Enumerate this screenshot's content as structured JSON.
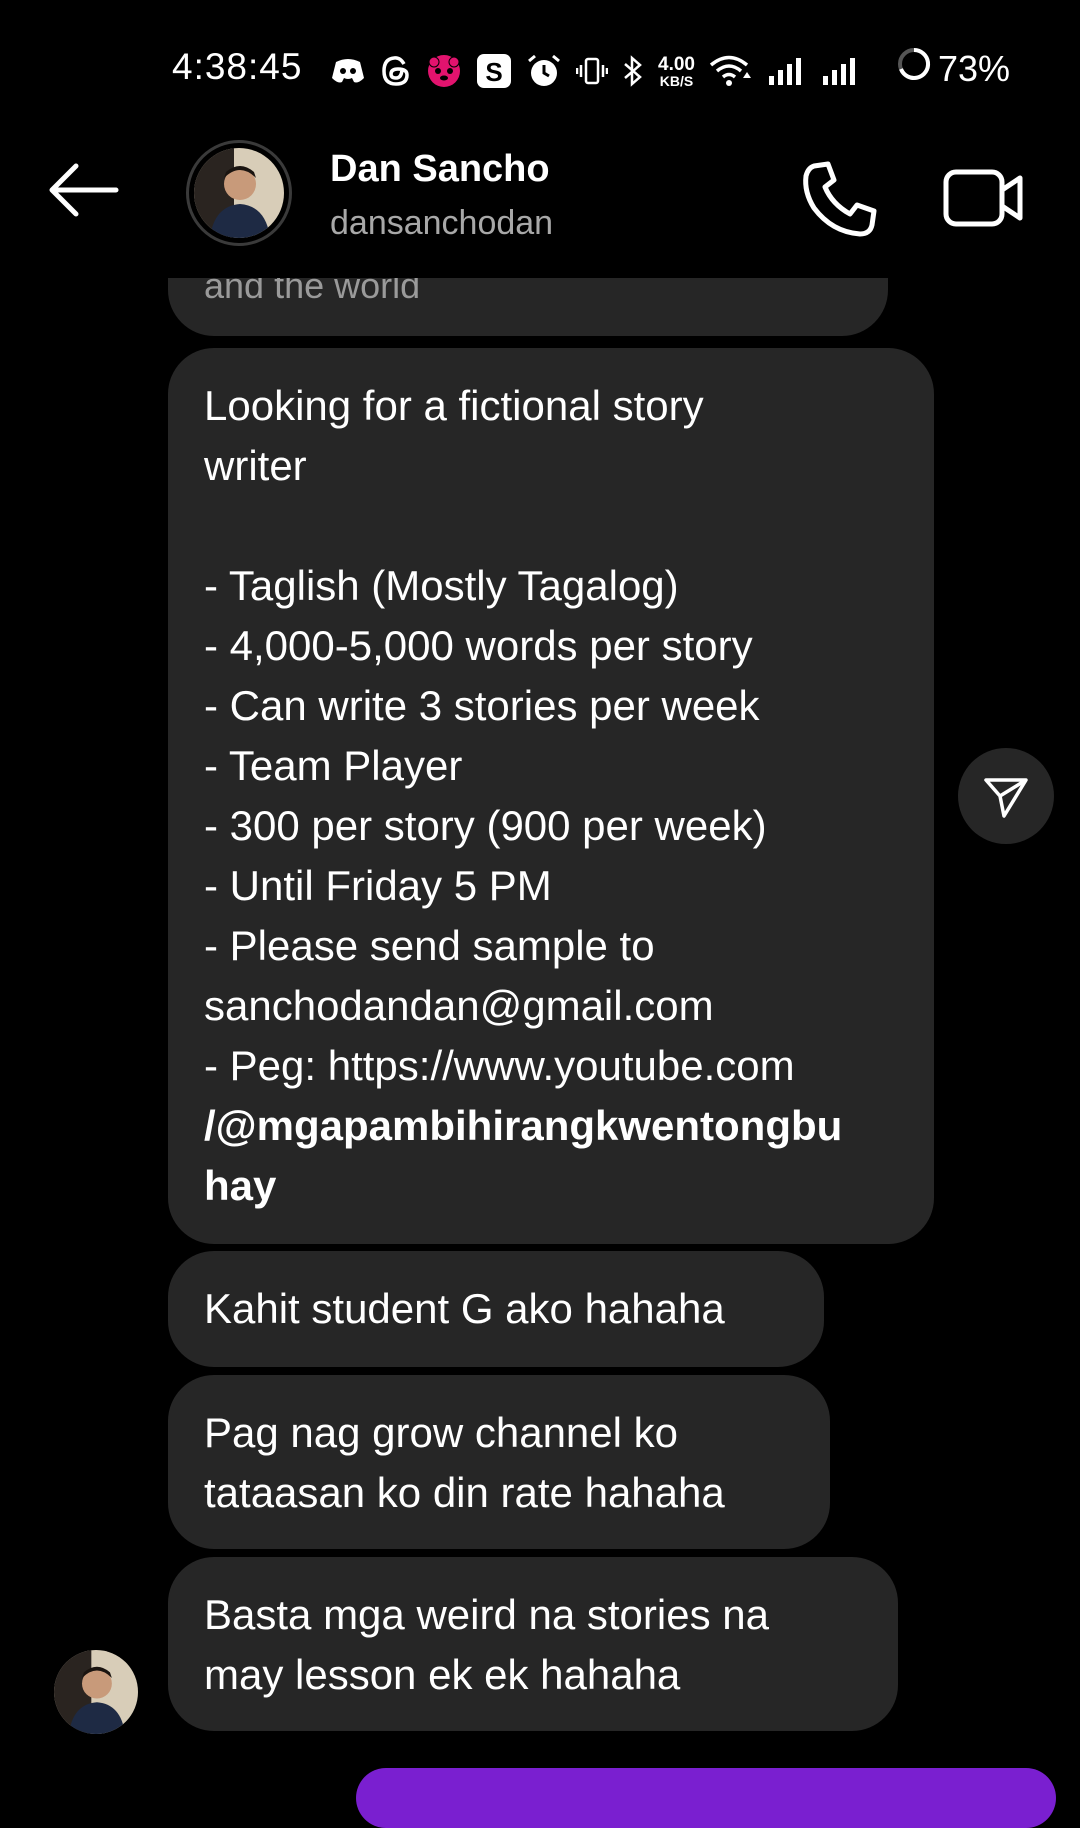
{
  "status_bar": {
    "time": "4:38:45",
    "net_speed_value": "4.00",
    "net_speed_unit": "KB/S",
    "battery": "73%",
    "icons": [
      "discord-icon",
      "threads-icon",
      "foodpanda-icon",
      "s-app-icon",
      "alarm-icon",
      "vibrate-icon",
      "bluetooth-icon",
      "wifi-icon",
      "signal-icon",
      "signal-icon",
      "battery-icon"
    ]
  },
  "header": {
    "name": "Dan Sancho",
    "username": "dansanchodan"
  },
  "messages": {
    "partial_text": "and the world",
    "post_lines": [
      "Looking for a fictional story",
      "writer",
      "",
      "- Taglish (Mostly Tagalog)",
      "- 4,000-5,000 words per story",
      "- Can write 3 stories per week",
      "- Team Player",
      "- 300 per story (900 per week)",
      "- Until Friday 5 PM",
      "- Please send sample to",
      "sanchodandan@gmail.com",
      "- Peg: https://www.youtube.com",
      "/@mgapambihirangkwentongbu",
      "hay"
    ],
    "msg2": "Kahit student G ako hahaha",
    "msg3_line1": "Pag nag grow channel ko",
    "msg3_line2": "tataasan ko din rate hahaha",
    "msg4_line1": "Basta mga weird na stories na",
    "msg4_line2": "may lesson ek ek hahaha"
  },
  "colors": {
    "background": "#000000",
    "bubble": "#262626",
    "secondary_text": "#a8a8a8",
    "accent": "#7a1fd0"
  }
}
